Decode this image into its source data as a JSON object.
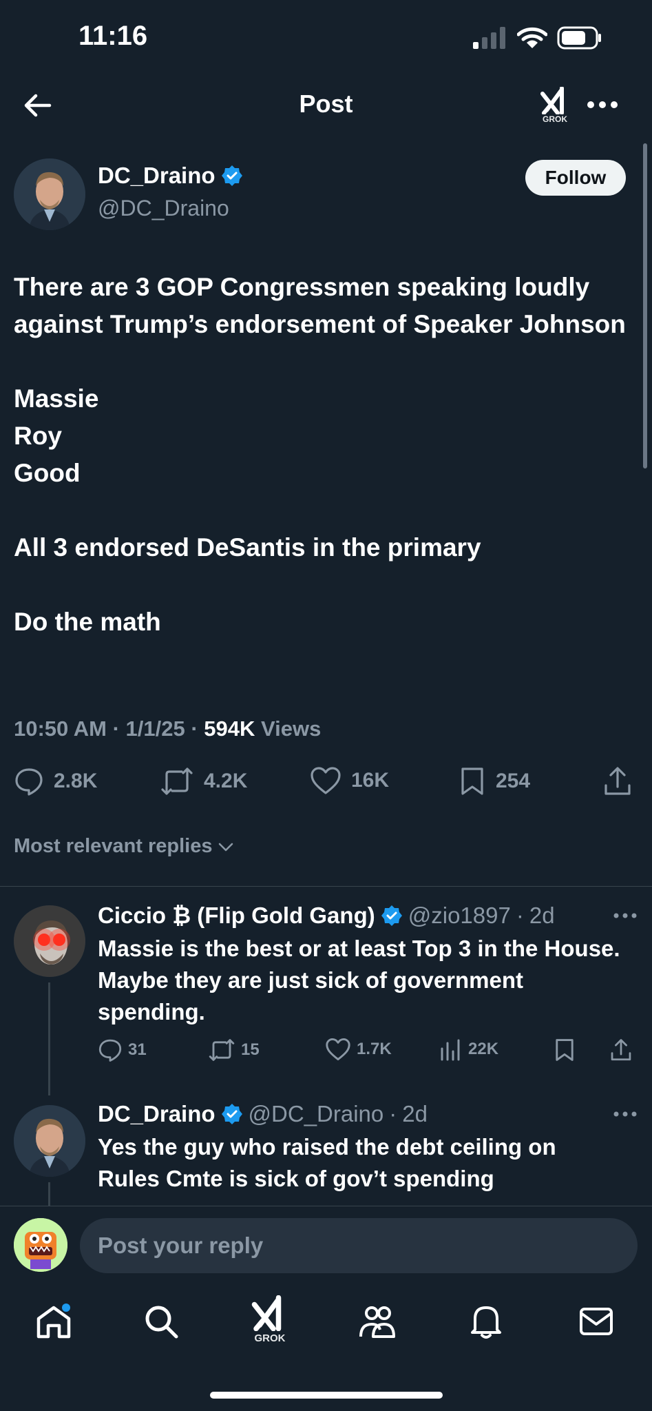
{
  "status_bar": {
    "time": "11:16"
  },
  "header": {
    "title": "Post",
    "grok_label": "GROK"
  },
  "post": {
    "author_name": "DC_Draino",
    "author_handle": "@DC_Draino",
    "follow_label": "Follow",
    "lines": [
      "There are 3 GOP Congressmen speaking loudly against Trump’s endorsement of Speaker Johnson",
      "",
      "Massie",
      "Roy",
      "Good",
      "",
      "All 3 endorsed DeSantis in the primary",
      "",
      "Do the math"
    ],
    "time": "10:50 AM",
    "date": "1/1/25",
    "views_count": "594K",
    "views_label": "Views",
    "stats": {
      "replies": "2.8K",
      "reposts": "4.2K",
      "likes": "16K",
      "bookmarks": "254"
    }
  },
  "replies_sort": "Most relevant replies",
  "replies": [
    {
      "name": "Ciccio ₿ (Flip Gold Gang)",
      "handle": "@zio1897",
      "time": "2d",
      "text": "Massie is the best or at least Top 3 in the House. Maybe they are just sick of government spending.",
      "stats": {
        "replies": "31",
        "reposts": "15",
        "likes": "1.7K",
        "views": "22K"
      }
    },
    {
      "name": "DC_Draino",
      "handle": "@DC_Draino",
      "time": "2d",
      "text": "Yes the guy who raised the debt ceiling on Rules Cmte is sick of gov’t spending"
    }
  ],
  "reply_composer": {
    "placeholder": "Post your reply"
  },
  "bottom_nav": {
    "grok_label": "GROK"
  },
  "colors": {
    "background": "#15202b",
    "verified": "#1d9bf0",
    "muted": "#8b98a5"
  }
}
